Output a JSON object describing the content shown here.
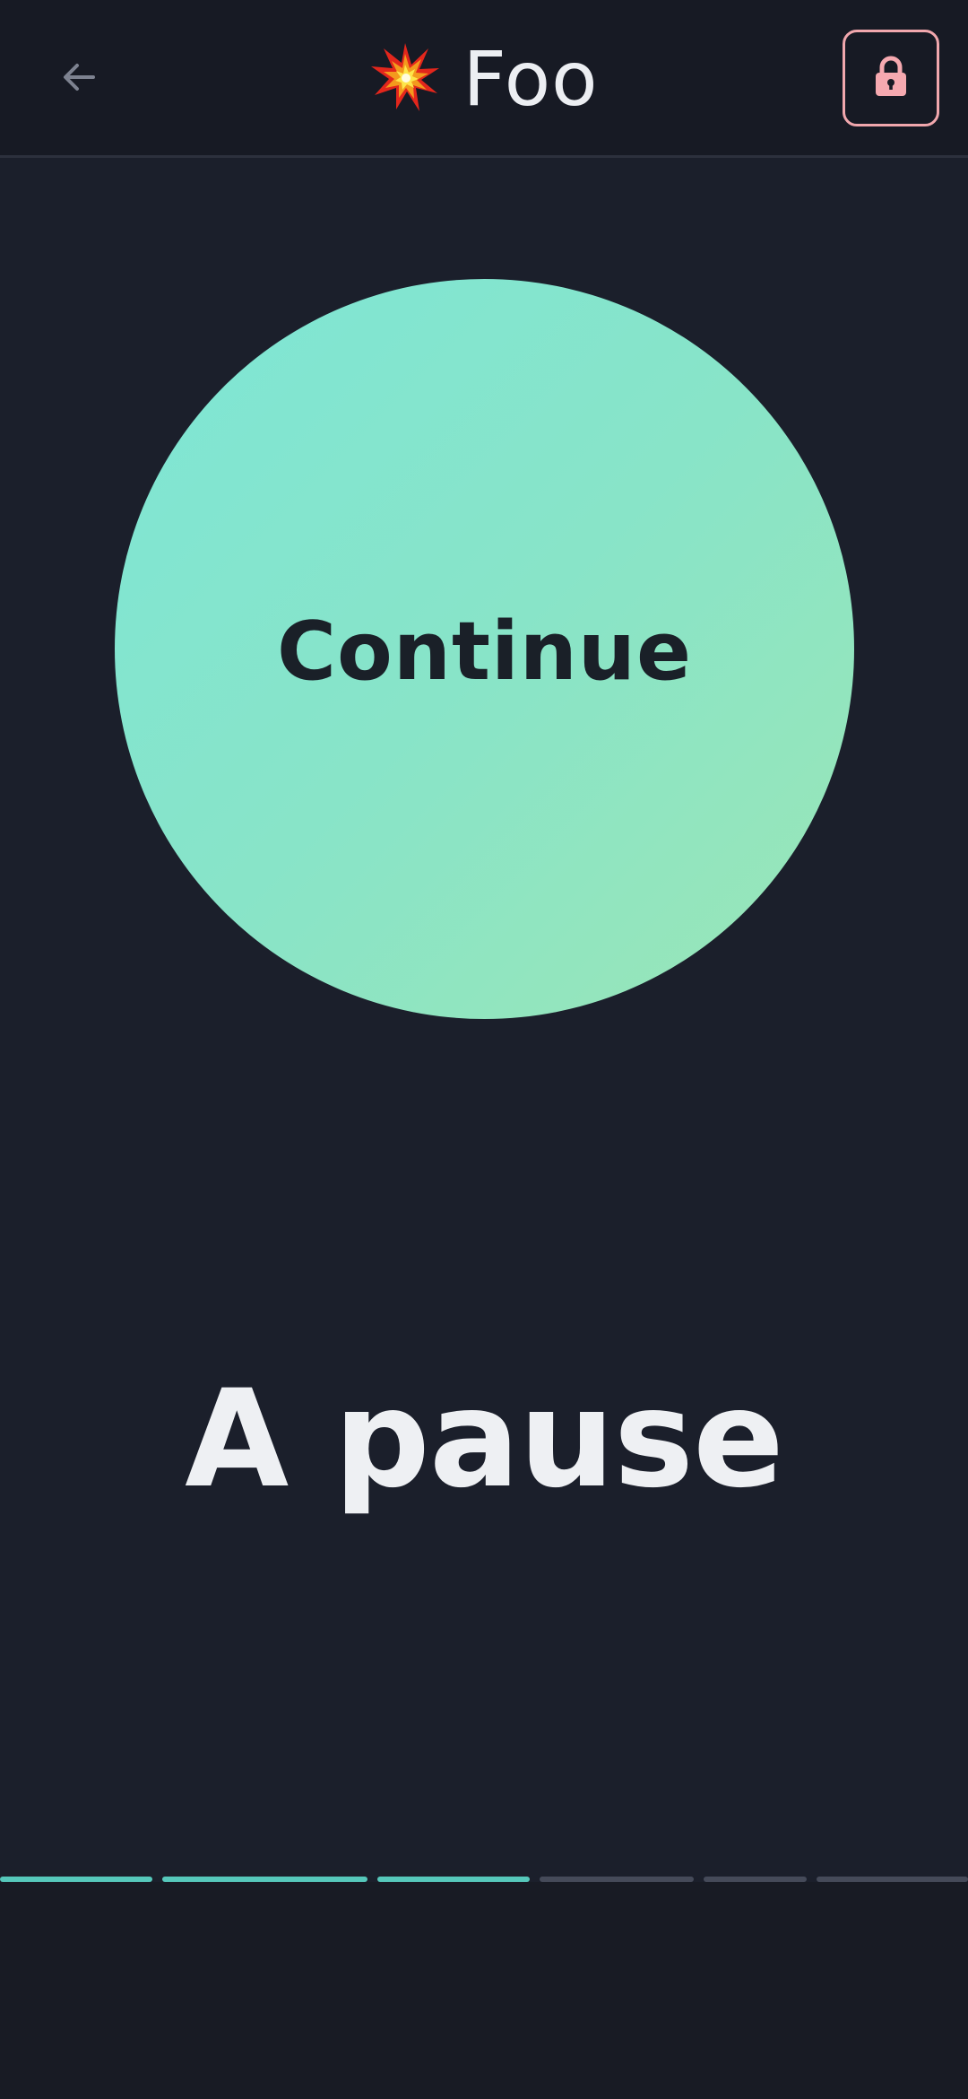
{
  "header": {
    "title_emoji": "💥",
    "title": "Foo",
    "back_icon": "arrow-left-icon",
    "lock_icon": "lock-icon"
  },
  "main": {
    "circle_button_label": "Continue",
    "headline": "A pause"
  },
  "progress": {
    "segments_total": 6,
    "segments_completed": 3
  },
  "colors": {
    "background": "#1b1f2b",
    "accent": "#56c8bb",
    "circle_gradient_start": "#7ee6d6",
    "circle_gradient_end": "#9be6b6",
    "lock_border": "#f1a7ad"
  }
}
